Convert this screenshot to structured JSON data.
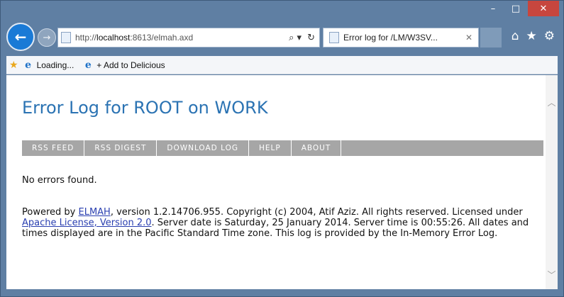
{
  "window": {
    "minimize_glyph": "–",
    "maximize_glyph": "□",
    "close_glyph": "✕"
  },
  "nav": {
    "back_glyph": "←",
    "forward_glyph": "→",
    "address": {
      "prefix": "http://",
      "host": "localhost",
      "rest": ":8613/elmah.axd"
    },
    "search_glyph": "⌕ ▾",
    "refresh_glyph": "↻",
    "tab": {
      "label": "Error log for /LM/W3SV...",
      "close_glyph": "✕"
    },
    "home_glyph": "⌂",
    "favorites_glyph": "★",
    "settings_glyph": "⚙"
  },
  "favorites_bar": {
    "add_star_glyph": "★",
    "items": [
      {
        "label": "Loading..."
      },
      {
        "label": "+ Add to Delicious"
      }
    ]
  },
  "page": {
    "title": "Error Log for ROOT on WORK",
    "menu": [
      "RSS FEED",
      "RSS DIGEST",
      "DOWNLOAD LOG",
      "HELP",
      "ABOUT"
    ],
    "no_errors": "No errors found.",
    "footer": {
      "part1": "Powered by ",
      "elmah_link": "ELMAH",
      "part2": ", version 1.2.14706.955. Copyright (c) 2004, Atif Aziz. All rights reserved. Licensed under ",
      "license_link": "Apache License, Version 2.0",
      "part3": ". Server date is Saturday, 25 January 2014. Server time is 00:55:26. All dates and times displayed are in the Pacific Standard Time zone. This log is provided by the In-Memory Error Log."
    }
  },
  "scrollbar": {
    "up_glyph": "︿",
    "down_glyph": "﹀"
  }
}
